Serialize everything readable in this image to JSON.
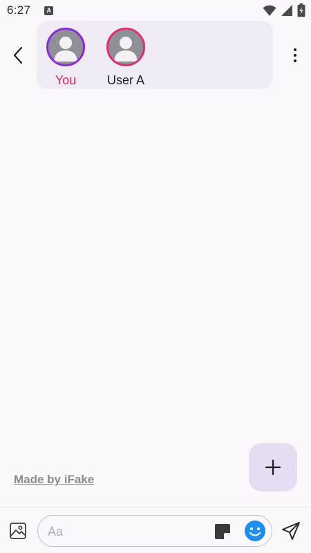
{
  "status_bar": {
    "time": "6:27",
    "notification_icon_letter": "A",
    "icons": [
      "wifi-icon",
      "signal-icon",
      "battery-charging-icon"
    ]
  },
  "header": {
    "back_icon": "chevron-left-icon",
    "menu_icon": "more-vertical-icon",
    "participants": [
      {
        "name": "You",
        "ring_color": "#8b2bd6",
        "name_color": "#e0245e",
        "avatar_icon": "person-icon"
      },
      {
        "name": "User A",
        "ring_color": "#e02e6e",
        "name_color": "#1c1b1f",
        "avatar_icon": "person-icon"
      }
    ]
  },
  "conversation": {
    "messages": []
  },
  "footer": {
    "made_by": "Made by iFake",
    "fab_icon": "plus-icon"
  },
  "composer": {
    "placeholder": "Aa",
    "value": "",
    "image_icon": "image-icon",
    "sticker_icon": "sticker-icon",
    "emoji_icon": "emoji-icon",
    "send_icon": "send-icon"
  },
  "colors": {
    "background": "#fcf7fc",
    "card": "#f1ebf6",
    "fab": "#e7ddf3",
    "accent_emoji": "#1e8ff0",
    "you_name": "#e0245e"
  }
}
